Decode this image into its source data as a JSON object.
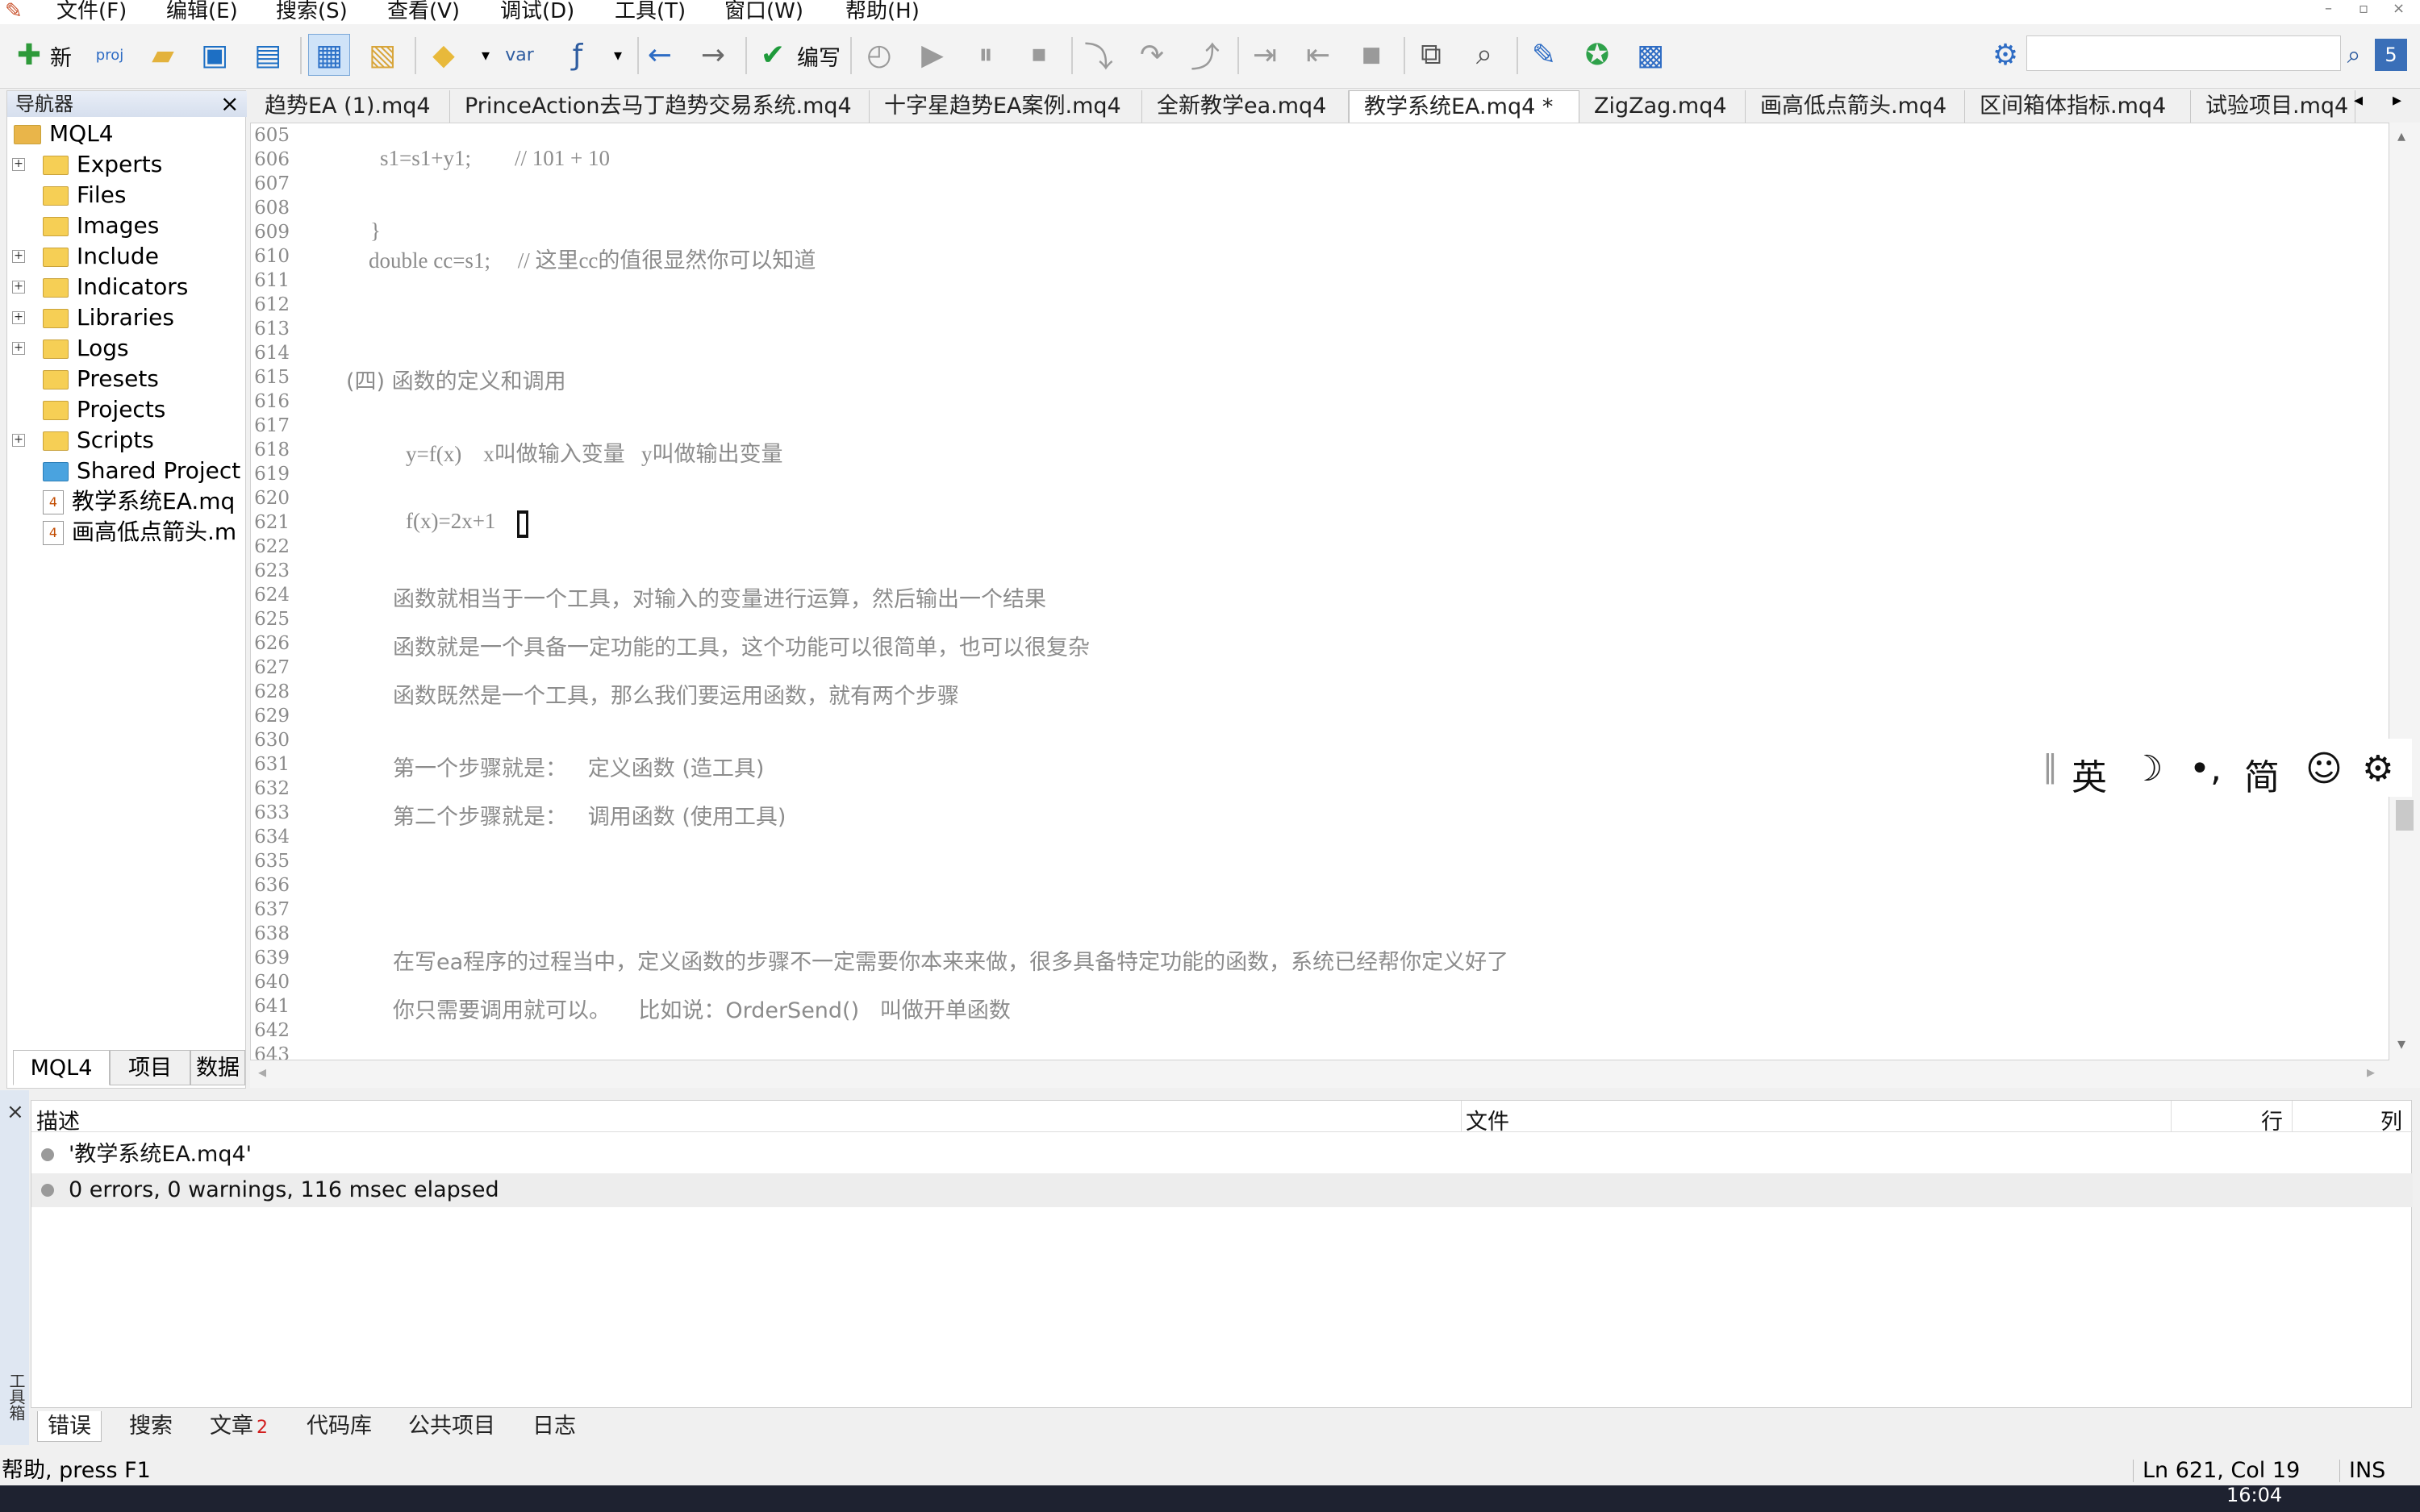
{
  "menu": {
    "file": "文件(F)",
    "edit": "编辑(E)",
    "search": "搜索(S)",
    "view": "查看(V)",
    "debug": "调试(D)",
    "tools": "工具(T)",
    "window": "窗口(W)",
    "help": "帮助(H)"
  },
  "toolbar": {
    "new_label": "新",
    "proj_label": "proj",
    "var_label": "var",
    "compile_label": "编写"
  },
  "navigator": {
    "title": "导航器",
    "root": "MQL4",
    "items": [
      {
        "label": "Experts",
        "expandable": true
      },
      {
        "label": "Files",
        "expandable": false
      },
      {
        "label": "Images",
        "expandable": false
      },
      {
        "label": "Include",
        "expandable": true
      },
      {
        "label": "Indicators",
        "expandable": true
      },
      {
        "label": "Libraries",
        "expandable": true
      },
      {
        "label": "Logs",
        "expandable": true
      },
      {
        "label": "Presets",
        "expandable": false
      },
      {
        "label": "Projects",
        "expandable": false
      },
      {
        "label": "Scripts",
        "expandable": true
      },
      {
        "label": "Shared Project",
        "expandable": false
      },
      {
        "label": "教学系统EA.mq",
        "expandable": false
      },
      {
        "label": "画高低点箭头.m",
        "expandable": false
      }
    ],
    "tabs": [
      "MQL4",
      "项目",
      "数据"
    ]
  },
  "file_tabs": [
    "趋势EA (1).mq4",
    "PrinceAction去马丁趋势交易系统.mq4",
    "十字星趋势EA案例.mq4",
    "全新教学ea.mq4",
    "教学系统EA.mq4 *",
    "ZigZag.mq4",
    "画高低点箭头.mq4",
    "区间箱体指标.mq4",
    "试验项目.mq4"
  ],
  "editor": {
    "line_numbers": [
      "605",
      "606",
      "607",
      "608",
      "609",
      "610",
      "611",
      "612",
      "613",
      "614",
      "615",
      "616",
      "617",
      "618",
      "619",
      "620",
      "621",
      "622",
      "623",
      "624",
      "625",
      "626",
      "627",
      "628",
      "629",
      "630",
      "631",
      "632",
      "633",
      "634",
      "635",
      "636",
      "637",
      "638",
      "639",
      "640",
      "641",
      "642",
      "643"
    ],
    "lines": {
      "l606": "s1=s1+y1;        // 101 + 10",
      "l609": "}",
      "l610": "double cc=s1;     // 这里cc的值很显然你可以知道",
      "l615": "(四) 函数的定义和调用",
      "l618": "y=f(x)    x叫做输入变量   y叫做输出变量",
      "l621": "f(x)=2x+1",
      "l624": "函数就相当于一个工具，对输入的变量进行运算，然后输出一个结果",
      "l626": "函数就是一个具备一定功能的工具，这个功能可以很简单，也可以很复杂",
      "l628": "函数既然是一个工具，那么我们要运用函数，就有两个步骤",
      "l631": "第一个步骤就是：   定义函数 (造工具)",
      "l633": "第二个步骤就是：   调用函数 (使用工具)",
      "l639": "在写ea程序的过程当中，定义函数的步骤不一定需要你本来来做，很多具备特定功能的函数，系统已经帮你定义好了",
      "l641": "你只需要调用就可以。    比如说：OrderSend()   叫做开单函数"
    }
  },
  "ime": {
    "lang": "英",
    "simplified": "简"
  },
  "output": {
    "col_desc": "描述",
    "col_file": "文件",
    "col_line": "行",
    "col_col": "列",
    "rows": [
      "'教学系统EA.mq4'",
      "0 errors, 0 warnings, 116 msec elapsed"
    ],
    "side_label": "工具箱"
  },
  "bottom_tabs": {
    "errors": "错误",
    "search": "搜索",
    "articles": "文章",
    "articles_badge": "2",
    "codebase": "代码库",
    "public": "公共项目",
    "journal": "日志"
  },
  "status": {
    "help": "帮助, press F1",
    "position": "Ln 621, Col 19",
    "mode": "INS",
    "clock": "16:04"
  }
}
